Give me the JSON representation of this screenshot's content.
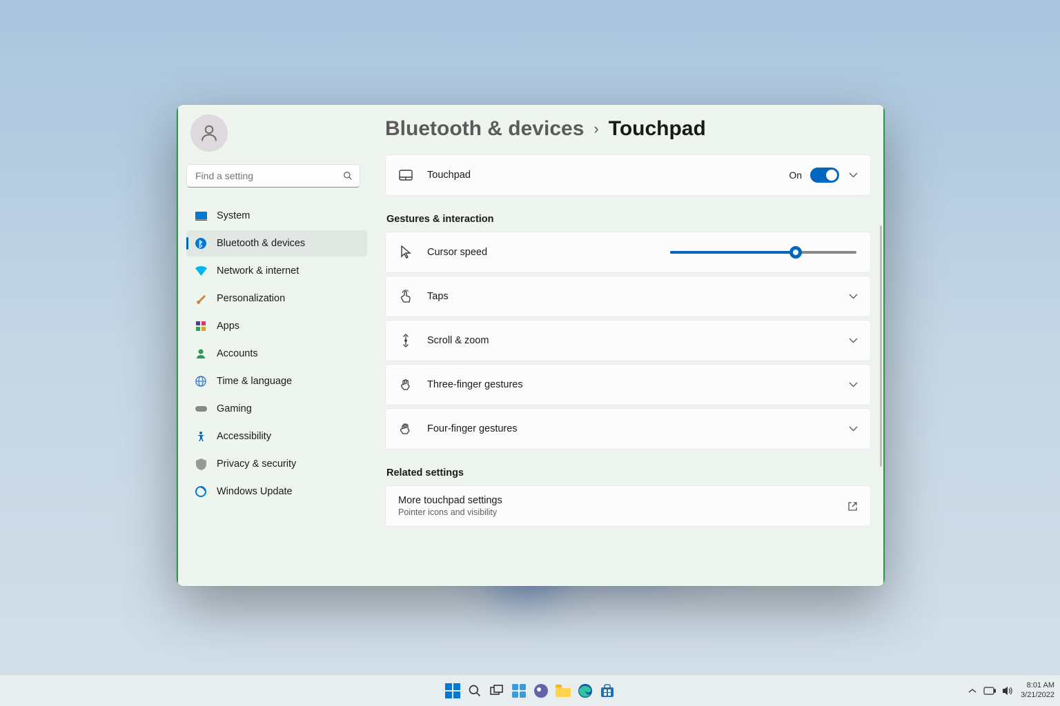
{
  "search": {
    "placeholder": "Find a setting"
  },
  "sidebar": {
    "items": [
      {
        "label": "System"
      },
      {
        "label": "Bluetooth & devices"
      },
      {
        "label": "Network & internet"
      },
      {
        "label": "Personalization"
      },
      {
        "label": "Apps"
      },
      {
        "label": "Accounts"
      },
      {
        "label": "Time & language"
      },
      {
        "label": "Gaming"
      },
      {
        "label": "Accessibility"
      },
      {
        "label": "Privacy & security"
      },
      {
        "label": "Windows Update"
      }
    ]
  },
  "breadcrumb": {
    "parent": "Bluetooth & devices",
    "current": "Touchpad"
  },
  "touchpad": {
    "label": "Touchpad",
    "status": "On"
  },
  "sections": {
    "gestures_title": "Gestures & interaction",
    "cursor_speed": "Cursor speed",
    "taps": "Taps",
    "scroll_zoom": "Scroll & zoom",
    "three_finger": "Three-finger gestures",
    "four_finger": "Four-finger gestures",
    "related_title": "Related settings",
    "more_label": "More touchpad settings",
    "more_sub": "Pointer icons and visibility"
  },
  "cursor_speed_value": 66,
  "taskbar": {
    "time": "8:01 AM",
    "date": "3/21/2022"
  }
}
